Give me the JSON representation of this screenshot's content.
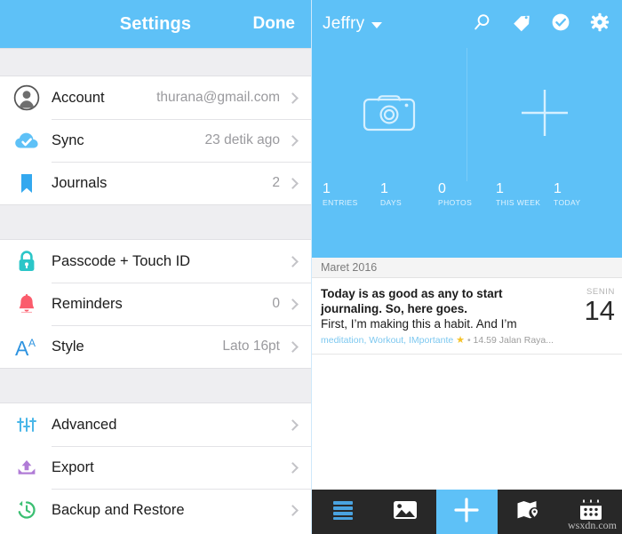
{
  "settings": {
    "header": {
      "title": "Settings",
      "done_label": "Done"
    },
    "groups": [
      {
        "rows": [
          {
            "icon": "account-avatar-icon",
            "label": "Account",
            "value": "thurana@gmail.com"
          },
          {
            "icon": "cloud-check-icon",
            "label": "Sync",
            "value": "23 detik ago"
          },
          {
            "icon": "bookmark-icon",
            "label": "Journals",
            "value": "2"
          }
        ]
      },
      {
        "rows": [
          {
            "icon": "lock-icon",
            "label": "Passcode + Touch ID",
            "value": ""
          },
          {
            "icon": "bell-icon",
            "label": "Reminders",
            "value": "0"
          },
          {
            "icon": "font-style-icon",
            "label": "Style",
            "value": "Lato 16pt"
          }
        ]
      },
      {
        "rows": [
          {
            "icon": "sliders-icon",
            "label": "Advanced",
            "value": ""
          },
          {
            "icon": "export-upload-icon",
            "label": "Export",
            "value": ""
          },
          {
            "icon": "backup-clock-icon",
            "label": "Backup and Restore",
            "value": ""
          }
        ]
      }
    ]
  },
  "journal": {
    "header": {
      "user_name": "Jeffry",
      "actions": [
        {
          "icon": "search-icon",
          "name": "search"
        },
        {
          "icon": "tag-icon",
          "name": "tags"
        },
        {
          "icon": "check-circle-icon",
          "name": "tasks"
        },
        {
          "icon": "gear-icon",
          "name": "settings"
        }
      ]
    },
    "quick_actions": [
      {
        "icon": "camera-icon",
        "name": "new-photo-entry"
      },
      {
        "icon": "plus-icon",
        "name": "new-entry"
      }
    ],
    "stats": [
      {
        "num": "1",
        "label": "ENTRIES"
      },
      {
        "num": "1",
        "label": "DAYS"
      },
      {
        "num": "0",
        "label": "PHOTOS"
      },
      {
        "num": "1",
        "label": "THIS WEEK"
      },
      {
        "num": "1",
        "label": "TODAY"
      }
    ],
    "month_header": "Maret 2016",
    "entries": [
      {
        "line1": "Today is as good as any to start",
        "line2": "journaling. So, here goes.",
        "line3": "First, I’m making this a habit. And I’m",
        "tags": "meditation, Workout, IMportante",
        "star": "★",
        "separator": "•",
        "meta": "14.59 Jalan Raya...",
        "day_of_week": "SENIN",
        "day_number": "14"
      }
    ]
  },
  "tabbar": {
    "items": [
      {
        "icon": "list-icon",
        "name": "entries-list",
        "active": false
      },
      {
        "icon": "photos-icon",
        "name": "photos",
        "active": false
      },
      {
        "icon": "plus-icon",
        "name": "new-entry",
        "active": true
      },
      {
        "icon": "map-pin-icon",
        "name": "map",
        "active": false
      },
      {
        "icon": "calendar-icon",
        "name": "calendar",
        "active": false
      }
    ]
  },
  "watermark": "wsxdn.com",
  "colors": {
    "brand_blue": "#5ec1f7",
    "tabbar_dark": "#282828",
    "group_gap": "#eeeef1",
    "value_gray": "#9a9a9e"
  }
}
